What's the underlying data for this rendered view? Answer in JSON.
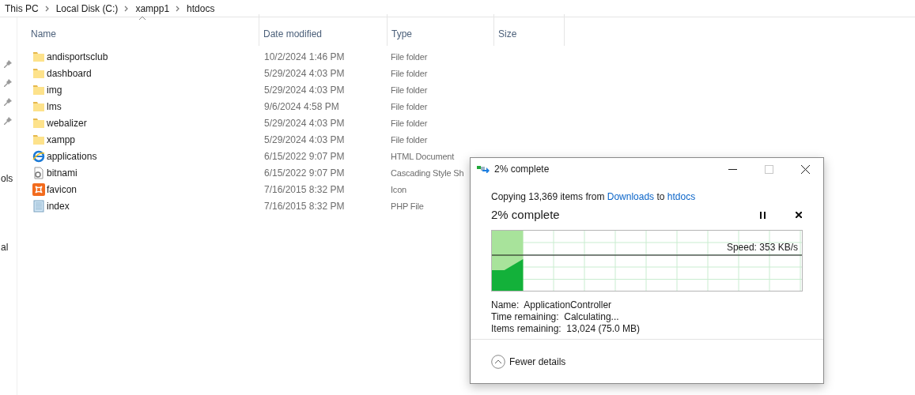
{
  "breadcrumb": [
    "This PC",
    "Local Disk (C:)",
    "xampp1",
    "htdocs"
  ],
  "nav_pane": {
    "labels": [
      "ols",
      "al"
    ]
  },
  "columns": [
    {
      "label": "Name",
      "sorted": true
    },
    {
      "label": "Date modified",
      "sorted": false
    },
    {
      "label": "Type",
      "sorted": false
    },
    {
      "label": "Size",
      "sorted": false
    }
  ],
  "rows": [
    {
      "kind": "folder",
      "name": "andisportsclub",
      "date": "10/2/2024 1:46 PM",
      "type": "File folder"
    },
    {
      "kind": "folder",
      "name": "dashboard",
      "date": "5/29/2024 4:03 PM",
      "type": "File folder"
    },
    {
      "kind": "folder",
      "name": "img",
      "date": "5/29/2024 4:03 PM",
      "type": "File folder"
    },
    {
      "kind": "folder",
      "name": "lms",
      "date": "9/6/2024 4:58 PM",
      "type": "File folder"
    },
    {
      "kind": "folder",
      "name": "webalizer",
      "date": "5/29/2024 4:03 PM",
      "type": "File folder"
    },
    {
      "kind": "folder",
      "name": "xampp",
      "date": "5/29/2024 4:03 PM",
      "type": "File folder"
    },
    {
      "kind": "html",
      "name": "applications",
      "date": "6/15/2022 9:07 PM",
      "type": "HTML Document"
    },
    {
      "kind": "css",
      "name": "bitnami",
      "date": "6/15/2022 9:07 PM",
      "type": "Cascading Style Sh"
    },
    {
      "kind": "icon",
      "name": "favicon",
      "date": "7/16/2015 8:32 PM",
      "type": "Icon"
    },
    {
      "kind": "php",
      "name": "index",
      "date": "7/16/2015 8:32 PM",
      "type": "PHP File"
    }
  ],
  "dialog": {
    "title": "2% complete",
    "copying": {
      "prefix": "Copying 13,369 items from",
      "source": "Downloads",
      "middle": "to",
      "destination": "htdocs"
    },
    "heading": "2% complete",
    "speed": "Speed: 353 KB/s",
    "level": 0.02,
    "details": [
      "Name:  ApplicationController",
      "Time remaining:  Calculating...",
      "Items remaining:  13,024 (75.0 MB)"
    ],
    "toggle": "Fewer details"
  }
}
